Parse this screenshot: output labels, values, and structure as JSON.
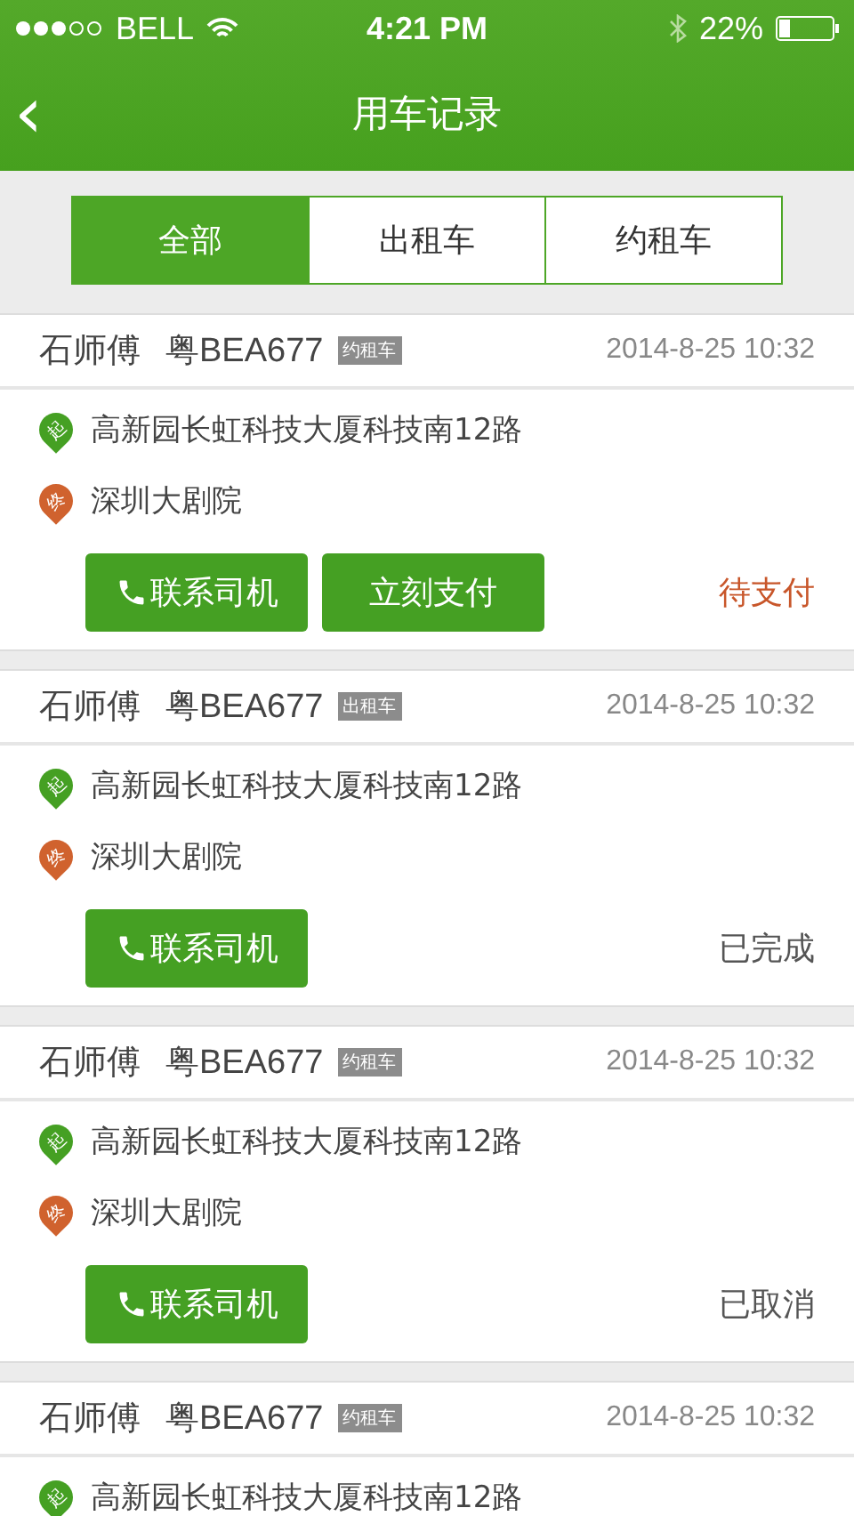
{
  "status_bar": {
    "carrier": "BELL",
    "time": "4:21 PM",
    "battery": "22%"
  },
  "nav": {
    "back": "‹",
    "title": "用车记录"
  },
  "tabs": [
    {
      "label": "全部",
      "selected": true
    },
    {
      "label": "出租车",
      "selected": false
    },
    {
      "label": "约租车",
      "selected": false
    }
  ],
  "orders": [
    {
      "driver": "石师傅",
      "plate": "粤BEA677",
      "car_type": "约租车",
      "time": "2014-8-25 10:32",
      "start_mark": "起",
      "start": "高新园长虹科技大厦科技南12路",
      "end_mark": "终",
      "end": "深圳大剧院",
      "buttons": [
        {
          "kind": "call",
          "label": "联系司机"
        },
        {
          "kind": "pay",
          "label": "立刻支付"
        }
      ],
      "status": {
        "text": "待支付",
        "color": "#c8562a"
      }
    },
    {
      "driver": "石师傅",
      "plate": "粤BEA677",
      "car_type": "出租车",
      "time": "2014-8-25 10:32",
      "start_mark": "起",
      "start": "高新园长虹科技大厦科技南12路",
      "end_mark": "终",
      "end": "深圳大剧院",
      "buttons": [
        {
          "kind": "call",
          "label": "联系司机"
        }
      ],
      "status": {
        "text": "已完成",
        "color": "#555555"
      }
    },
    {
      "driver": "石师傅",
      "plate": "粤BEA677",
      "car_type": "约租车",
      "time": "2014-8-25 10:32",
      "start_mark": "起",
      "start": "高新园长虹科技大厦科技南12路",
      "end_mark": "终",
      "end": "深圳大剧院",
      "buttons": [
        {
          "kind": "call",
          "label": "联系司机"
        }
      ],
      "status": {
        "text": "已取消",
        "color": "#555555"
      }
    },
    {
      "driver": "石师傅",
      "plate": "粤BEA677",
      "car_type": "约租车",
      "time": "2014-8-25 10:32",
      "start_mark": "起",
      "start": "高新园长虹科技大厦科技南12路"
    }
  ]
}
